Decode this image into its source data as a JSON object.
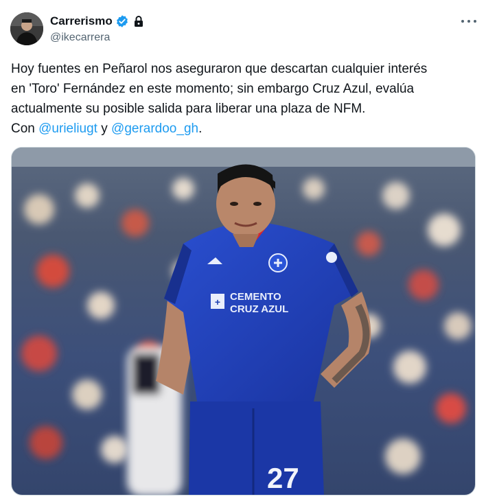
{
  "author": {
    "name": "Carrerismo",
    "handle": "@ikecarrera",
    "avatar_icon": "avatar-photo",
    "verified_icon": "verified-badge-icon",
    "protected_icon": "lock-icon",
    "verified_color": "#1d9bf0"
  },
  "more_icon": "more-options-icon",
  "tweet": {
    "line1": "Hoy fuentes en Peñarol nos aseguraron que descartan cualquier interés",
    "line2": "en 'Toro'  Fernández en este momento; sin embargo Cruz Azul, evalúa",
    "line3": "actualmente su posible salida para liberar una plaza de NFM.",
    "line4_prefix": "Con ",
    "mention1": "@urieliugt",
    "line4_mid": " y ",
    "mention2": "@gerardoo_gh",
    "line4_suffix": ".",
    "mention_color": "#1d9bf0"
  },
  "media": {
    "jersey_text_1": "CEMENTO",
    "jersey_text_2": "CRUZ AZUL",
    "shorts_number": "27",
    "jersey_color": "#1d3fb0"
  }
}
